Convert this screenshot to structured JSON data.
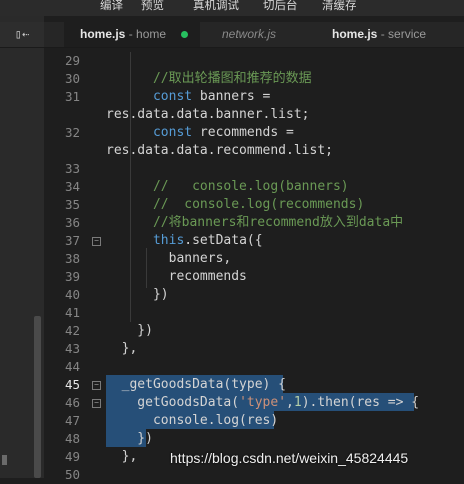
{
  "menu": [
    "编译",
    "预览",
    "真机调试",
    "切后台",
    "清缓存"
  ],
  "tabs": {
    "toggle_icon": "▯⇠",
    "active": {
      "name": "home.js",
      "sep": " - ",
      "dir": "home"
    },
    "network": {
      "name": "network.js"
    },
    "service": {
      "name": "home.js",
      "sep": " - ",
      "dir": "service"
    }
  },
  "lines": [
    {
      "n": "29",
      "text": ""
    },
    {
      "n": "30",
      "text": "      //取出轮播图和推荐的数据"
    },
    {
      "n": "31",
      "text": "      const banners ="
    },
    {
      "n": "",
      "text": "res.data.data.banner.list;"
    },
    {
      "n": "32",
      "text": "      const recommends ="
    },
    {
      "n": "",
      "text": "res.data.data.recommend.list;"
    },
    {
      "n": "33",
      "text": ""
    },
    {
      "n": "34",
      "text": "      //   console.log(banners)"
    },
    {
      "n": "35",
      "text": "      //  console.log(recommends)"
    },
    {
      "n": "36",
      "text": "      //将banners和recommend放入到data中"
    },
    {
      "n": "37",
      "text": "      this.setData({"
    },
    {
      "n": "38",
      "text": "        banners,"
    },
    {
      "n": "39",
      "text": "        recommends"
    },
    {
      "n": "40",
      "text": "      })"
    },
    {
      "n": "41",
      "text": ""
    },
    {
      "n": "42",
      "text": "    })"
    },
    {
      "n": "43",
      "text": "  },"
    },
    {
      "n": "44",
      "text": ""
    },
    {
      "n": "45",
      "text": "  _getGoodsData(type) {"
    },
    {
      "n": "46",
      "text": "    getGoodsData('type',1).then(res => {"
    },
    {
      "n": "47",
      "text": "      console.log(res)"
    },
    {
      "n": "48",
      "text": "    })"
    },
    {
      "n": "49",
      "text": "  },"
    },
    {
      "n": "50",
      "text": ""
    }
  ],
  "watermark": "https://blog.csdn.net/weixin_45824445",
  "colors": {
    "selection": "#264f78",
    "comment": "#6a9955",
    "keyword": "#569cd6",
    "modified_dot": "#27c05f"
  }
}
